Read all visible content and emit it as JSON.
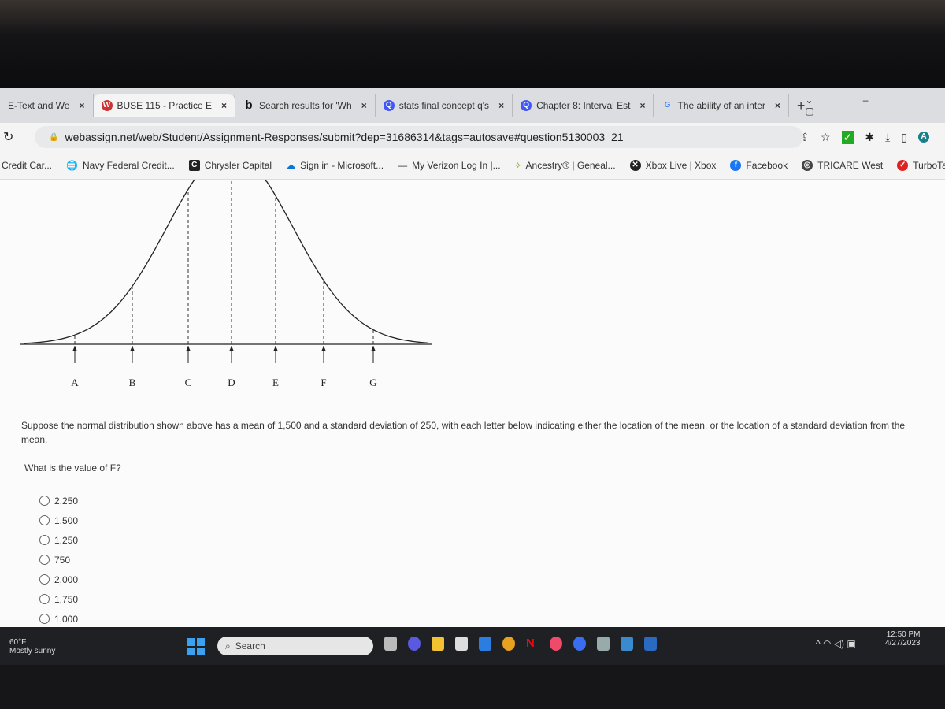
{
  "browser": {
    "tabs": [
      {
        "label": "E-Text and We",
        "icon": "page-icon"
      },
      {
        "label": "BUSE 115 - Practice E",
        "icon": "webassign-icon",
        "active": true
      },
      {
        "label": "Search results for 'Wh",
        "icon": "bing-icon"
      },
      {
        "label": "stats final concept q's",
        "icon": "quizlet-icon"
      },
      {
        "label": "Chapter 8: Interval Est",
        "icon": "quizlet-icon"
      },
      {
        "label": "The ability of an inter",
        "icon": "google-icon"
      }
    ],
    "new_tab": "+",
    "close": "×",
    "url": "webassign.net/web/Student/Assignment-Responses/submit?dep=31686314&tags=autosave#question5130003_21",
    "bookmarks": [
      "Credit Car...",
      "Navy Federal Credit...",
      "Chrysler Capital",
      "Sign in - Microsoft...",
      "My Verizon Log In |...",
      "Ancestry® | Geneal...",
      "Xbox Live | Xbox",
      "Facebook",
      "TRICARE West",
      "TurboTax"
    ],
    "profile_initial": "A"
  },
  "diagram": {
    "labels": [
      "A",
      "B",
      "C",
      "D",
      "E",
      "F",
      "G"
    ]
  },
  "question": {
    "text": "Suppose the normal distribution shown above has a mean of 1,500 and a standard deviation of 250, with each letter below indicating either the location of the mean, or the location of a standard deviation from the mean.",
    "prompt": "What is the value of F?",
    "options": [
      "2,250",
      "1,500",
      "1,250",
      "750",
      "2,000",
      "1,750",
      "1,000"
    ]
  },
  "taskbar": {
    "weather_temp": "60°F",
    "weather_desc": "Mostly sunny",
    "search": "Search",
    "time": "12:50 PM",
    "date": "4/27/2023"
  }
}
